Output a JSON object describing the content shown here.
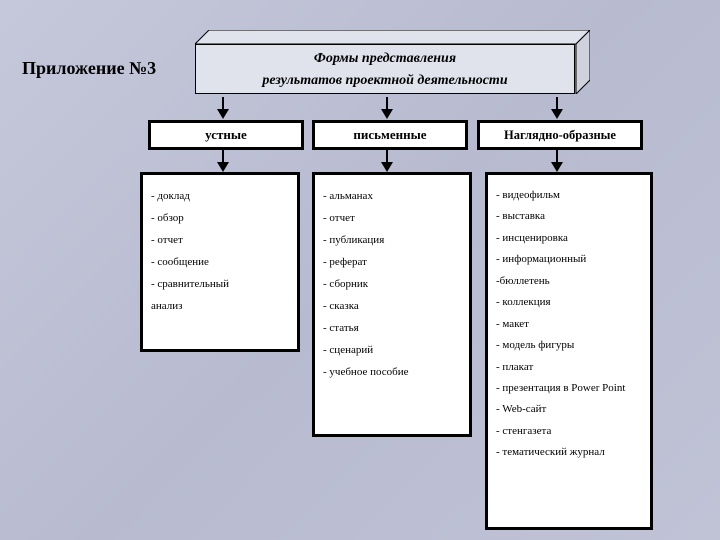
{
  "page_title": "Приложение №3",
  "banner": {
    "line1": "Формы представления",
    "line2": "результатов проектной деятельности"
  },
  "categories": [
    {
      "label": "устные"
    },
    {
      "label": "письменные"
    },
    {
      "label": "Наглядно-образные"
    }
  ],
  "lists": {
    "oral": [
      "доклад",
      "обзор",
      "отчет",
      "сообщение",
      "сравнительный"
    ],
    "oral_tail": "анализ",
    "written": [
      "альманах",
      "отчет",
      "публикация",
      "реферат",
      "сборник",
      "сказка",
      "статья",
      "сценарий",
      "учебное пособие"
    ],
    "visual": [
      "видеофильм",
      "выставка",
      "инсценировка",
      "информационный"
    ],
    "visual_tail1": "-бюллетень",
    "visual2": [
      "коллекция",
      "макет",
      "модель фигуры",
      "плакат",
      "презентация в Power Point",
      "Web-сайт",
      "стенгазета",
      "тематический журнал"
    ]
  }
}
